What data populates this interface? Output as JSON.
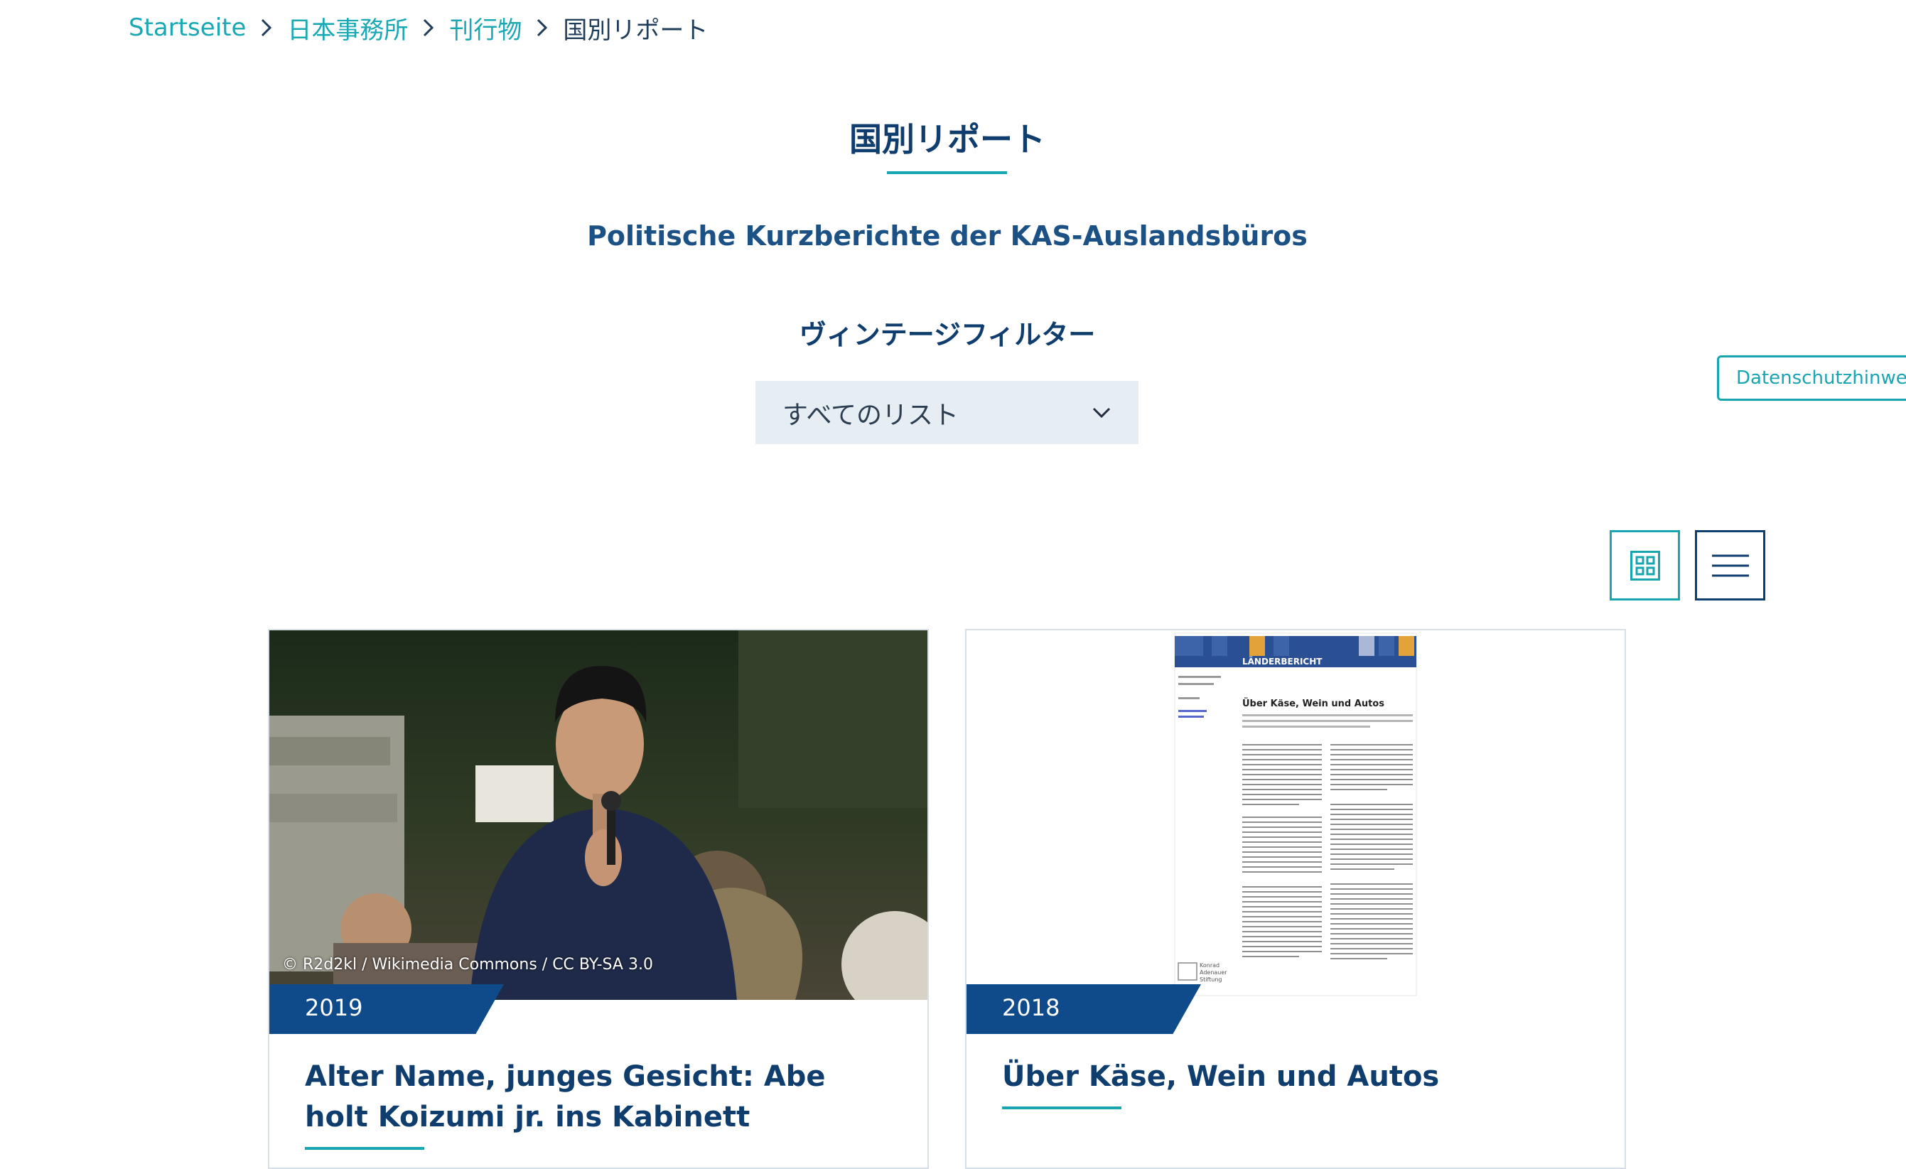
{
  "breadcrumb": {
    "items": [
      "Startseite",
      "日本事務所",
      "刊行物"
    ],
    "current": "国別リポート"
  },
  "page": {
    "title": "国別リポート",
    "subtitle": "Politische Kurzberichte der KAS-Auslandsbüros"
  },
  "filter": {
    "heading": "ヴィンテージフィルター",
    "selected": "すべてのリスト"
  },
  "privacy_button": "Datenschutzhinweis",
  "view_toggle": {
    "grid_icon": "grid-icon",
    "list_icon": "hamburger-list-icon"
  },
  "cards": [
    {
      "year": "2019",
      "title": "Alter Name, junges Gesicht: Abe holt Koizumi jr. ins Kabinett",
      "image_credit": "© R2d2kl / Wikimedia Commons / CC BY-SA 3.0"
    },
    {
      "year": "2018",
      "title": "Über Käse, Wein und Autos",
      "thumbnail": {
        "banner": "LÄNDERBERICHT",
        "doc_title": "Über Käse, Wein und Autos",
        "logo_lines": [
          "Konrad",
          "Adenauer",
          "Stiftung"
        ]
      }
    }
  ],
  "colors": {
    "teal": "#18a5b2",
    "navy": "#0f3d6e",
    "badge_blue": "#0f4a8a",
    "select_bg": "#e6edf3"
  }
}
